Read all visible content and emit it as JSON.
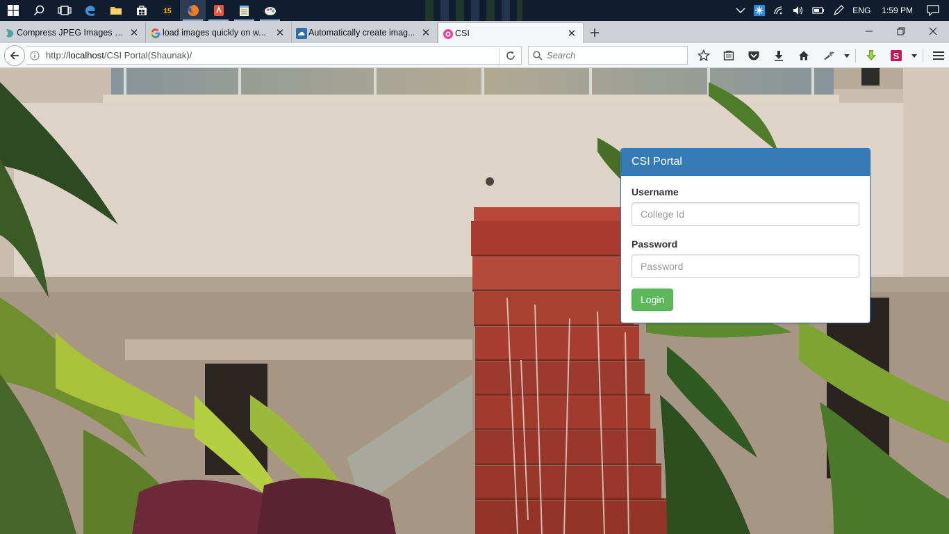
{
  "taskbar": {
    "pinned": [
      "windows-start",
      "search",
      "task-view",
      "edge",
      "file-explorer",
      "store",
      "app-15",
      "firefox",
      "pdf-app",
      "notepad",
      "paint"
    ],
    "tray": {
      "language": "ENG",
      "time": "1:59 PM"
    }
  },
  "browser": {
    "tabs": [
      {
        "title": "Compress JPEG Images O...",
        "favicon": "compress-icon"
      },
      {
        "title": "load images quickly on w...",
        "favicon": "google-icon"
      },
      {
        "title": "Automatically create imag...",
        "favicon": "cloud-icon"
      },
      {
        "title": "CSI",
        "favicon": "csi-icon"
      }
    ],
    "url_prefix": "http://",
    "url_host": "localhost",
    "url_path": "/CSI Portal(Shaunak)/",
    "search_placeholder": "Search"
  },
  "login": {
    "heading": "CSI Portal",
    "username_label": "Username",
    "username_placeholder": "College Id",
    "password_label": "Password",
    "password_placeholder": "Password",
    "login_button": "Login"
  },
  "colors": {
    "panel_primary": "#337ab7",
    "login_button": "#5cb85c"
  }
}
